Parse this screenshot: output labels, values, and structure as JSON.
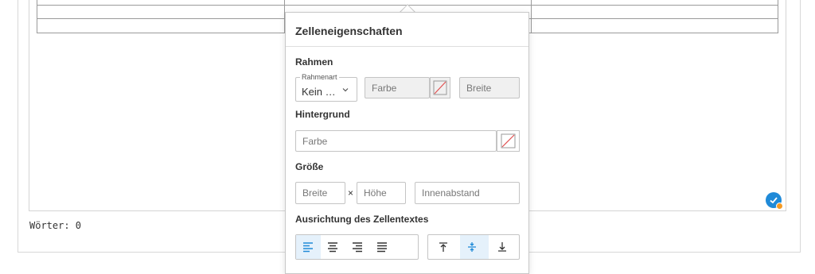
{
  "status": {
    "word_count": "Wörter: 0"
  },
  "popup": {
    "title": "Zelleneigenschaften",
    "border": {
      "heading": "Rahmen",
      "style_legend": "Rahmenart",
      "style_value": "Kein …",
      "color_placeholder": "Farbe",
      "width_placeholder": "Breite"
    },
    "background": {
      "heading": "Hintergrund",
      "color_placeholder": "Farbe"
    },
    "size": {
      "heading": "Größe",
      "width_placeholder": "Breite",
      "times": "×",
      "height_placeholder": "Höhe",
      "padding_placeholder": "Innenabstand"
    },
    "alignment": {
      "heading": "Ausrichtung des Zellentextes",
      "horizontal_active": "left",
      "vertical_active": "middle"
    }
  },
  "colors": {
    "accent": "#1f8ad8",
    "active_bg": "#e5f1fb",
    "badge_dot": "#f59a23"
  },
  "icons": [
    "chevron-down-icon",
    "no-color-icon",
    "align-left-icon",
    "align-center-icon",
    "align-right-icon",
    "align-justify-icon",
    "align-top-icon",
    "align-middle-icon",
    "align-bottom-icon",
    "check-badge-icon"
  ]
}
